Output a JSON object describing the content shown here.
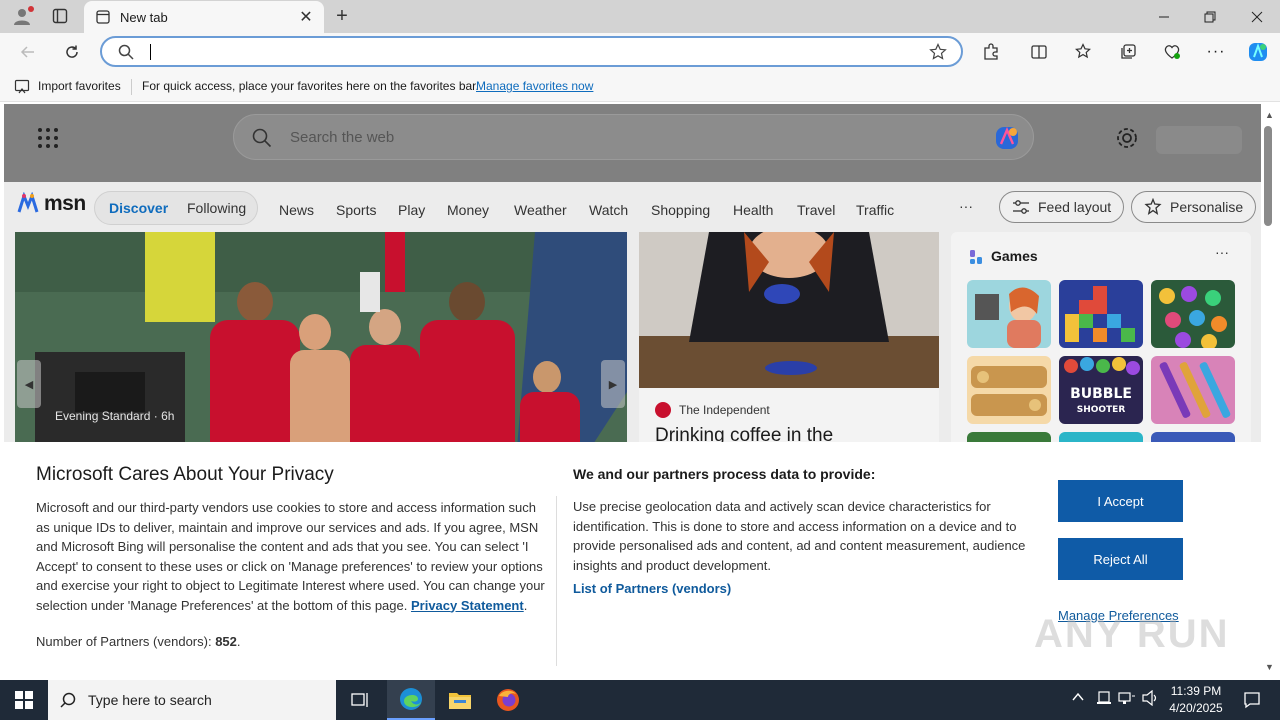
{
  "browser": {
    "tab_title": "New tab",
    "address_value": "",
    "window_controls": [
      "minimize",
      "restore",
      "close"
    ]
  },
  "favorites_bar": {
    "import_label": "Import favorites",
    "message": "For quick access, place your favorites here on the favorites bar.",
    "manage_link": "Manage favorites now"
  },
  "newtab": {
    "search_placeholder": "Search the web"
  },
  "msn_nav": {
    "logo": "msn",
    "segments": [
      "Discover",
      "Following"
    ],
    "links": [
      "News",
      "Sports",
      "Play",
      "Money",
      "Weather",
      "Watch",
      "Shopping",
      "Health",
      "Travel",
      "Traffic"
    ],
    "more": "···",
    "feed_layout": "Feed layout",
    "personalise": "Personalise"
  },
  "cards": {
    "hero_source": "Evening Standard · 6h",
    "mid_source": "The Independent",
    "mid_headline": "Drinking coffee in the",
    "games_title": "Games",
    "games_more": "···"
  },
  "privacy": {
    "title": "Microsoft Cares About Your Privacy",
    "body": "Microsoft and our third-party vendors use cookies to store and access information such as unique IDs to deliver, maintain and improve our services and ads. If you agree, MSN and Microsoft Bing will personalise the content and ads that you see. You can select 'I Accept' to consent to these uses or click on 'Manage preferences' to review your options and exercise your right to object to Legitimate Interest where used.  You can change your selection under 'Manage Preferences' at the bottom of this page.",
    "privacy_link": "Privacy Statement",
    "partners_label": "Number of Partners (vendors):",
    "partners_count": "852",
    "right_title": "We and our partners process data to provide:",
    "right_body": "Use precise geolocation data and actively scan device characteristics for identification. This is done to store and access information on a device and to provide personalised ads and content, ad and content measurement, audience insights and product development.",
    "list_partners": "List of Partners (vendors)",
    "accept": "I Accept",
    "reject": "Reject All",
    "manage": "Manage Preferences"
  },
  "taskbar": {
    "search_placeholder": "Type here to search",
    "time": "11:39 PM",
    "date": "4/20/2025"
  },
  "watermark": "ANY RUN",
  "colors": {
    "accent": "#0f5ba7",
    "link": "#0f6cbd",
    "taskbar": "#1f2a38"
  }
}
